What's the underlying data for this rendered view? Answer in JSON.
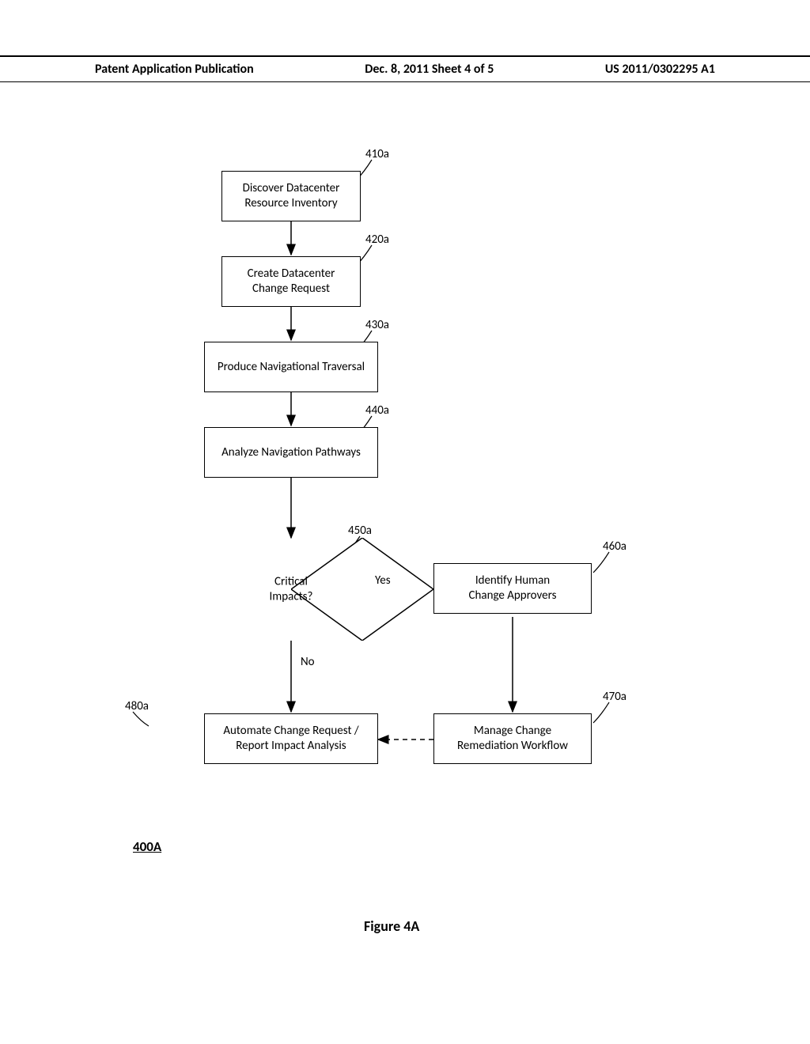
{
  "header": {
    "left": "Patent Application Publication",
    "center": "Dec. 8, 2011   Sheet 4 of 5",
    "right": "US 2011/0302295 A1"
  },
  "boxes": {
    "s410": "Discover Datacenter\nResource Inventory",
    "s420": "Create Datacenter\nChange Request",
    "s430": "Produce Navigational Traversal",
    "s440": "Analyze Navigation Pathways",
    "s460": "Identify Human\nChange Approvers",
    "s470": "Manage Change\nRemediation Workflow",
    "s480": "Automate Change Request /\nReport Impact Analysis"
  },
  "decision": {
    "s450": "Critical\nImpacts?"
  },
  "refs": {
    "r410": "410a",
    "r420": "420a",
    "r430": "430a",
    "r440": "440a",
    "r450": "450a",
    "r460": "460a",
    "r470": "470a",
    "r480": "480a"
  },
  "labels": {
    "yes": "Yes",
    "no": "No"
  },
  "figure": {
    "id": "400A",
    "caption": "Figure 4A"
  }
}
